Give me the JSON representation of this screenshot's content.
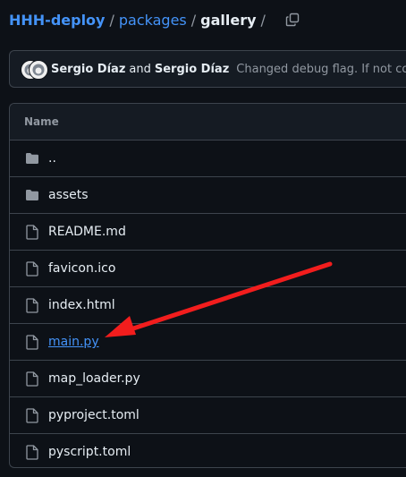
{
  "breadcrumb": {
    "repo": "HHH-deploy",
    "sep1": "/",
    "folder": "packages",
    "sep2": "/",
    "current": "gallery",
    "sep3": "/"
  },
  "commit": {
    "author1": "Sergio Díaz",
    "conjunction": "and",
    "author2": "Sergio Díaz",
    "message": "Changed debug flag. If not co"
  },
  "file_table": {
    "header": "Name",
    "rows": [
      {
        "name": "..",
        "type": "directory-up",
        "icon": "folder-icon",
        "link": false
      },
      {
        "name": "assets",
        "type": "directory",
        "icon": "folder-icon",
        "link": false
      },
      {
        "name": "README.md",
        "type": "file",
        "icon": "file-icon",
        "link": false
      },
      {
        "name": "favicon.ico",
        "type": "file",
        "icon": "file-icon",
        "link": false
      },
      {
        "name": "index.html",
        "type": "file",
        "icon": "file-icon",
        "link": false
      },
      {
        "name": "main.py",
        "type": "file",
        "icon": "file-icon",
        "link": true
      },
      {
        "name": "map_loader.py",
        "type": "file",
        "icon": "file-icon",
        "link": false
      },
      {
        "name": "pyproject.toml",
        "type": "file",
        "icon": "file-icon",
        "link": false
      },
      {
        "name": "pyscript.toml",
        "type": "file",
        "icon": "file-icon",
        "link": false
      }
    ]
  },
  "annotation": {
    "shape": "arrow",
    "points_to": "main.py",
    "color": "#f21d1d"
  },
  "colors": {
    "background": "#0d1117",
    "link": "#4493f8",
    "border": "#3d444d",
    "muted": "#9198a1"
  }
}
